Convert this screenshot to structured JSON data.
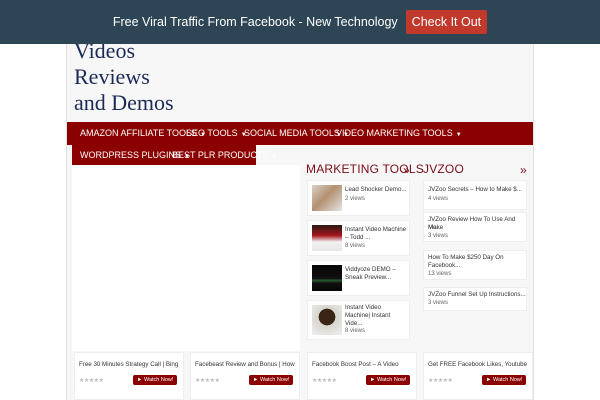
{
  "notification": {
    "text": "Free Viral Traffic From Facebook - New Technology",
    "cta": "Check It Out"
  },
  "site": {
    "title_lines": [
      "Videos",
      "Reviews",
      "and Demos"
    ]
  },
  "nav": {
    "items": [
      "AMAZON AFFILIATE TOOLS",
      "SEO TOOLS",
      "SOCIAL MEDIA TOOLS",
      "VIDEO MARKETING TOOLS",
      "WORDPRESS PLUGINS",
      "BEST PLR PRODUCTS"
    ]
  },
  "marketing_tools": {
    "heading": "MARKETING TOOLS",
    "items": [
      {
        "title_1": "Lead Shocker Demo...",
        "title_2": "",
        "title_3": "",
        "views": "2 views"
      },
      {
        "title_1": "Instant Video Machine",
        "title_2": "– Todd ...",
        "title_3": "",
        "views": "8 views"
      },
      {
        "title_1": "Viddyoze DEMO –",
        "title_2": "Sneak Preview...",
        "title_3": "",
        "views": ""
      },
      {
        "title_1": "Instant Video",
        "title_2": "Machine| Instant",
        "title_3": "Vide...",
        "views": "8 views"
      }
    ]
  },
  "jvzoo": {
    "heading": "JVZOO",
    "items": [
      {
        "title_1": "JVZoo Secrets – How to Make $...",
        "title_2": "",
        "views": "4 views"
      },
      {
        "title_1": "JVZoo Review How To Use And Make",
        "title_2": "Mo...",
        "views": "3 views"
      },
      {
        "title_1": "How To Make $250 Day On",
        "title_2": "Facebook...",
        "views": "13 views"
      },
      {
        "title_1": "JVZoo Funnel Set Up Instructions...",
        "title_2": "",
        "views": "3 views"
      }
    ]
  },
  "cards": [
    {
      "title": "Free 30 Minutes Strategy Call | Bing",
      "button": "Watch Now!"
    },
    {
      "title": "Facebeast Review and Bonus | How",
      "button": "Watch Now!"
    },
    {
      "title": "Facebook Boost Post – A Video",
      "button": "Watch Now!"
    },
    {
      "title": "Get FREE Facebook Likes, Youtube",
      "button": "Watch Now!"
    }
  ],
  "colors": {
    "topbar": "#2d4555",
    "cta": "#c0392b",
    "close": "#2ecc9a",
    "nav": "#8b0000",
    "title": "#1b2a56",
    "section_heading": "#7a0d16"
  },
  "icons": {
    "close": "close-icon",
    "caret": "caret-down-icon",
    "arrows": "double-chevron-right-icon",
    "stars": "star-rating-icon"
  }
}
